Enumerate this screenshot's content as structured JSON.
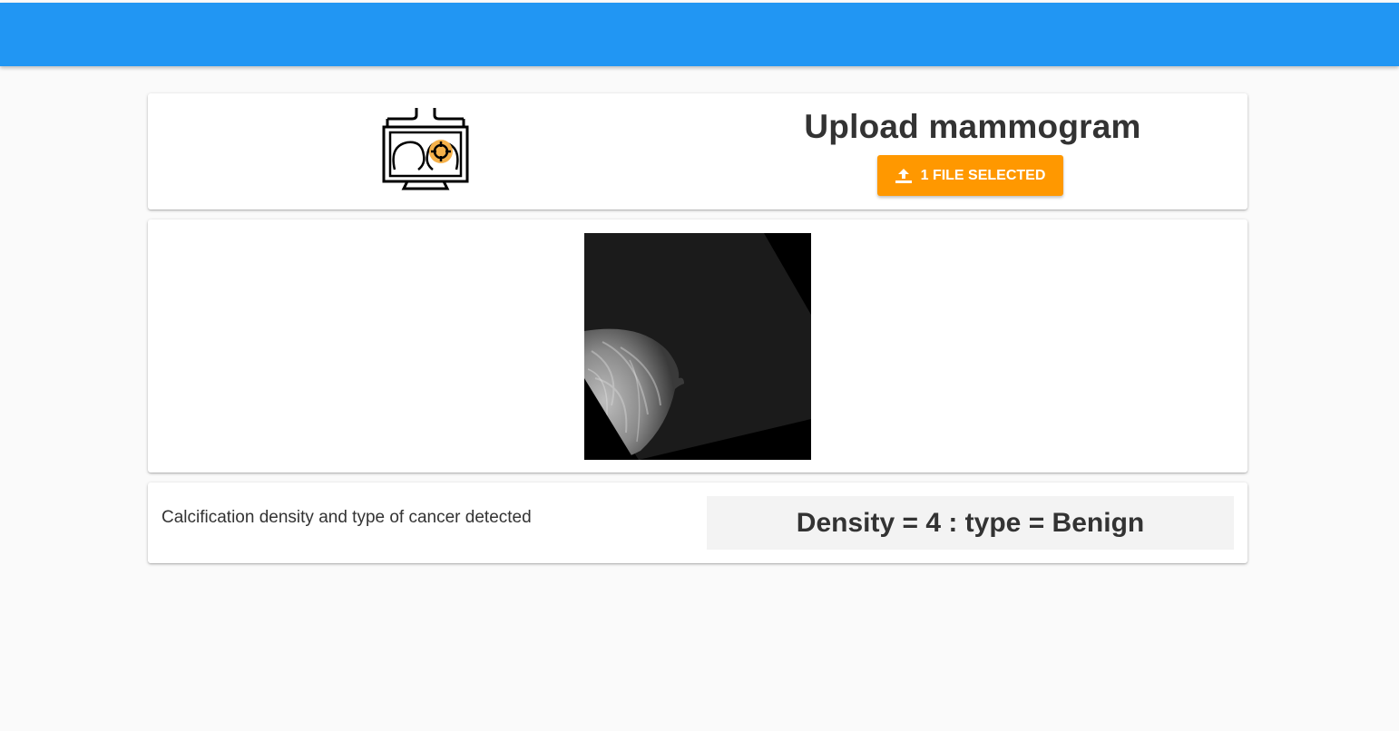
{
  "header": {
    "color": "#2196f3"
  },
  "upload": {
    "logo_icon": "mammography-monitor-icon",
    "title": "Upload mammogram",
    "button_label": "1 FILE SELECTED",
    "button_icon": "upload-icon",
    "button_color": "#ff9800"
  },
  "preview": {
    "image": "mammogram-image"
  },
  "result": {
    "label": "Calcification density and type of cancer detected",
    "value": "Density = 4 : type = Benign"
  }
}
